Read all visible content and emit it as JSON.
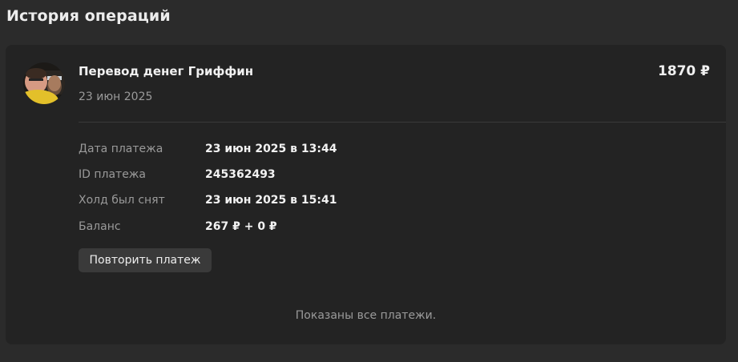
{
  "page": {
    "title": "История операций"
  },
  "operation": {
    "avatar_icon": "user-photo",
    "title": "Перевод денег Гриффин",
    "date": "23 июн 2025",
    "amount": "1870 ₽",
    "details": [
      {
        "label": "Дата платежа",
        "value": "23 июн 2025 в 13:44"
      },
      {
        "label": "ID платежа",
        "value": "245362493"
      },
      {
        "label": "Холд был снят",
        "value": "23 июн 2025 в 15:41"
      },
      {
        "label": "Баланс",
        "value": "267 ₽ + 0 ₽"
      }
    ],
    "repeat_label": "Повторить платеж"
  },
  "footer": {
    "note": "Показаны все платежи."
  },
  "colors": {
    "page_bg": "#2b2b2b",
    "card_bg": "#232323",
    "button_bg": "#3a3a3a"
  }
}
